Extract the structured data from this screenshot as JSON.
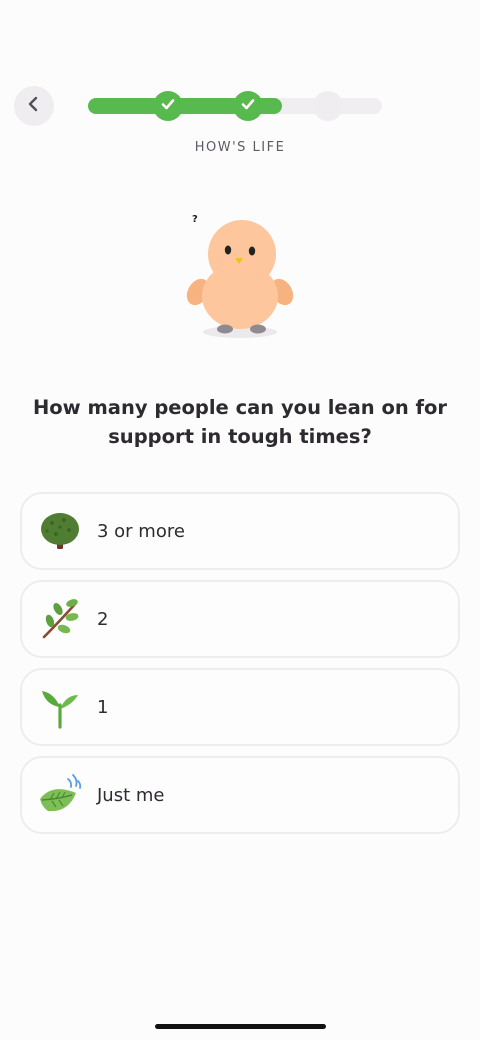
{
  "header": {
    "back_icon": "chevron-left-icon",
    "progress": {
      "completed_steps": 2,
      "total_steps": 3,
      "fill_fraction": 0.66
    },
    "section_label": "HOW'S LIFE"
  },
  "mascot": {
    "icon": "confused-bird-mascot",
    "thought": "?"
  },
  "question": "How many people can you lean on for support in tough times?",
  "options": [
    {
      "label": "3 or more",
      "icon": "tree-icon"
    },
    {
      "label": "2",
      "icon": "leafy-branch-icon"
    },
    {
      "label": "1",
      "icon": "seedling-icon"
    },
    {
      "label": "Just me",
      "icon": "leaf-in-wind-icon"
    }
  ],
  "colors": {
    "accent_green": "#58b94e",
    "track": "#f0eef1",
    "background": "#fdfcfd",
    "option_border": "#eeecef"
  }
}
